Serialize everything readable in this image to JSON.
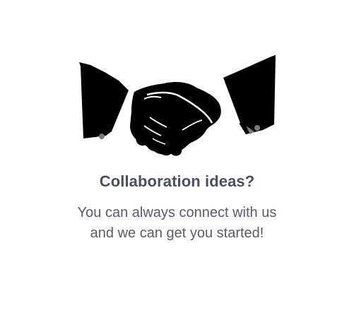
{
  "illustration": {
    "icon": "handshake-icon",
    "colors": {
      "silhouette": "#000000",
      "highlight": "#ffffff",
      "cufflink": "#7a7a7a"
    }
  },
  "heading": "Collaboration ideas?",
  "message": {
    "line1": "You can always connect with us",
    "line2": "and we can get you started!"
  },
  "colors": {
    "heading": "#4a4f63",
    "message": "#565b6e"
  }
}
